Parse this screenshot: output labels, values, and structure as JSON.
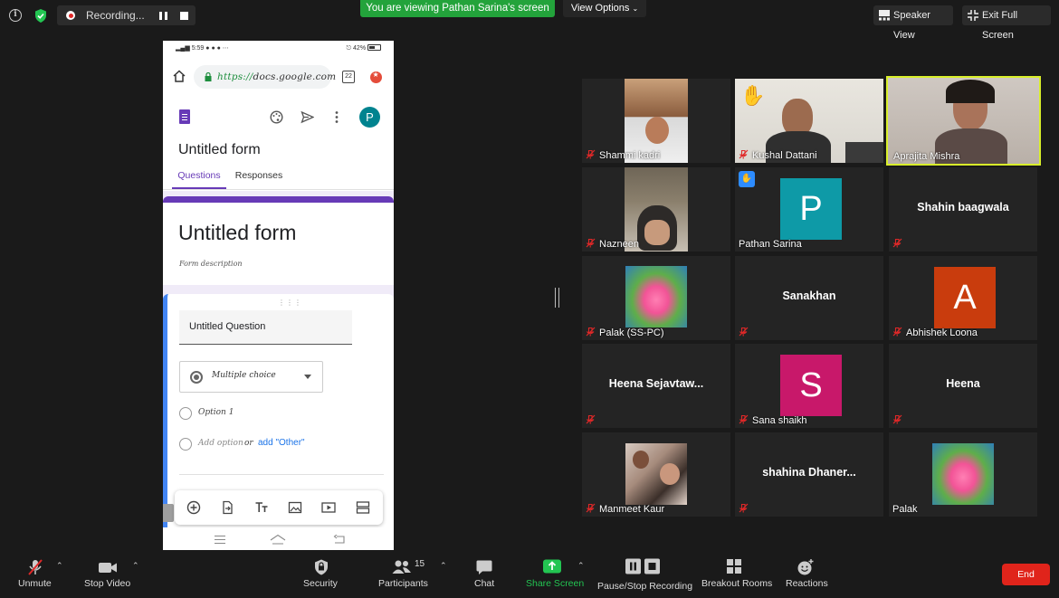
{
  "topbar": {
    "recording_label": "Recording...",
    "viewing_banner": "You are viewing Pathan Sarina's screen",
    "view_options": "View Options",
    "speaker_view": "Speaker View",
    "exit_full_screen": "Exit Full Screen"
  },
  "shared_screen": {
    "status_left": "5:59",
    "status_right": "42%",
    "url_scheme": "https://",
    "url_host": "docs.google.com",
    "tabs_count": "22",
    "avatar_letter": "P",
    "doc_title": "Untitled form",
    "tabs": [
      "Questions",
      "Responses"
    ],
    "form_title": "Untitled form",
    "form_description": "Form description",
    "question_title": "Untitled Question",
    "question_type": "Multiple choice",
    "option_1": "Option 1",
    "add_option": "Add option",
    "or_text": "or",
    "add_other": "add \"Other\""
  },
  "participants": [
    {
      "name": "Shammi kadri",
      "kind": "video"
    },
    {
      "name": "Kushal Dattani",
      "kind": "video"
    },
    {
      "name": "Aprajita Mishra",
      "kind": "video"
    },
    {
      "name": "Nazneen",
      "kind": "video"
    },
    {
      "name": "Pathan Sarina",
      "kind": "avatar",
      "letter": "P",
      "color": "#0e9aa7"
    },
    {
      "name": "Shahin baagwala",
      "kind": "name"
    },
    {
      "name": "Palak (SS-PC)",
      "kind": "photo"
    },
    {
      "name": "Sanakhan",
      "kind": "name"
    },
    {
      "name": "Abhishek Loona",
      "kind": "avatar",
      "letter": "A",
      "color": "#c93c0d"
    },
    {
      "name": "Heena  Sejavtaw...",
      "kind": "name"
    },
    {
      "name": "Sana shaikh",
      "kind": "avatar",
      "letter": "S",
      "color": "#c8186a"
    },
    {
      "name": "Heena",
      "kind": "name"
    },
    {
      "name": "Manmeet Kaur",
      "kind": "photo"
    },
    {
      "name": "shahina  Dhaner...",
      "kind": "name"
    },
    {
      "name": "Palak",
      "kind": "photo"
    }
  ],
  "bottombar": {
    "unmute": "Unmute",
    "stop_video": "Stop Video",
    "security": "Security",
    "participants": "Participants",
    "participants_count": "15",
    "chat": "Chat",
    "share_screen": "Share Screen",
    "pause_stop_recording": "Pause/Stop Recording",
    "breakout_rooms": "Breakout Rooms",
    "reactions": "Reactions",
    "end": "End"
  },
  "colors": {
    "banner_green": "#23a33b",
    "forms_purple": "#673ab7",
    "active_speaker": "#d9ef2a",
    "end_red": "#e0241b",
    "share_green": "#23c552"
  }
}
